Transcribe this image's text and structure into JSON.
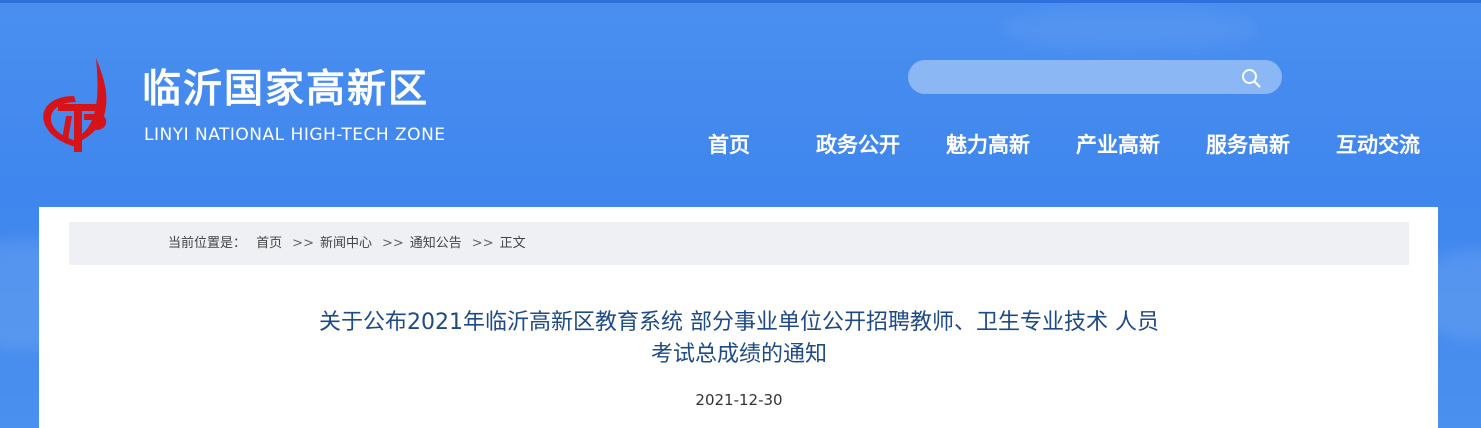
{
  "header": {
    "title": "临沂国家高新区",
    "subtitle": "LINYI NATIONAL HIGH-TECH ZONE",
    "logo_icon": "red-flame-logo-icon",
    "search": {
      "placeholder": "",
      "icon": "search-icon"
    }
  },
  "nav": {
    "items": [
      {
        "label": "首页"
      },
      {
        "label": "政务公开"
      },
      {
        "label": "魅力高新"
      },
      {
        "label": "产业高新"
      },
      {
        "label": "服务高新"
      },
      {
        "label": "互动交流"
      }
    ]
  },
  "breadcrumb": {
    "prefix": "当前位置是：",
    "items": [
      {
        "label": "首页"
      },
      {
        "label": "新闻中心"
      },
      {
        "label": "通知公告"
      },
      {
        "label": "正文"
      }
    ],
    "separator": ">>"
  },
  "article": {
    "title_line1": "关于公布2021年临沂高新区教育系统 部分事业单位公开招聘教师、卫生专业技术 人员",
    "title_line2": "考试总成绩的通知",
    "date": "2021-12-30"
  },
  "colors": {
    "header_blue": "#3f86ee",
    "logo_red": "#d7131a",
    "title_blue": "#1e4a86",
    "breadcrumb_bg": "#eef0f3"
  }
}
